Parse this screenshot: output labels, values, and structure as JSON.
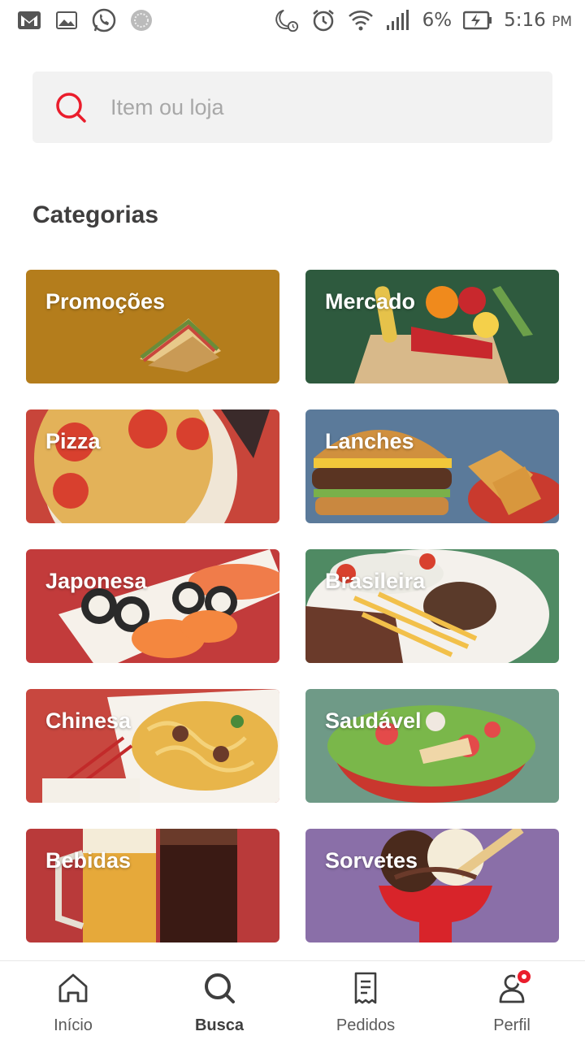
{
  "status_bar": {
    "battery": "6%",
    "time": "5:16",
    "ampm": "PM",
    "left_icons": [
      "gmail-icon",
      "gallery-icon",
      "whatsapp-icon",
      "sync-icon"
    ],
    "right_icons": [
      "night-mode-icon",
      "alarm-icon",
      "wifi-icon",
      "signal-icon",
      "battery-charging-icon"
    ]
  },
  "search": {
    "placeholder": "Item ou loja",
    "accent": "#ea1d2c"
  },
  "section_title": "Categorias",
  "categories": [
    {
      "label": "Promoções",
      "color": "#b47d1c"
    },
    {
      "label": "Mercado",
      "color": "#2e5a3e"
    },
    {
      "label": "Pizza",
      "color": "#b8483a"
    },
    {
      "label": "Lanches",
      "color": "#5b7a9a"
    },
    {
      "label": "Japonesa",
      "color": "#c23b3b"
    },
    {
      "label": "Brasileira",
      "color": "#4f8a63"
    },
    {
      "label": "Chinesa",
      "color": "#c8473f"
    },
    {
      "label": "Saudável",
      "color": "#6f9a87"
    },
    {
      "label": "Bebidas",
      "color": "#b93a3a"
    },
    {
      "label": "Sorvetes",
      "color": "#8a6fa8"
    }
  ],
  "bottom_nav": {
    "items": [
      {
        "label": "Início",
        "icon": "home-icon"
      },
      {
        "label": "Busca",
        "icon": "search-icon",
        "active": true
      },
      {
        "label": "Pedidos",
        "icon": "orders-icon"
      },
      {
        "label": "Perfil",
        "icon": "profile-icon",
        "badge": true
      }
    ]
  }
}
